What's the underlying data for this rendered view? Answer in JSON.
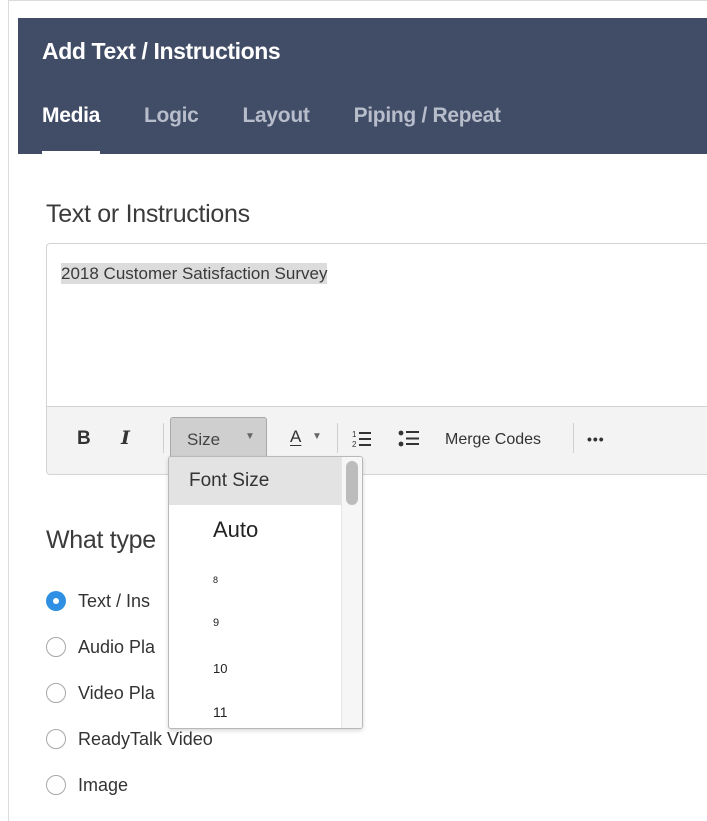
{
  "header": {
    "title": "Add Text / Instructions",
    "tabs": [
      {
        "label": "Media",
        "active": true
      },
      {
        "label": "Logic",
        "active": false
      },
      {
        "label": "Layout",
        "active": false
      },
      {
        "label": "Piping / Repeat",
        "active": false
      }
    ]
  },
  "editor": {
    "section_title": "Text or Instructions",
    "content": "2018 Customer Satisfaction Survey",
    "toolbar": {
      "bold_label": "B",
      "italic_label": "I",
      "size_label": "Size",
      "color_label": "A",
      "merge_codes_label": "Merge Codes",
      "more_label": "•••"
    }
  },
  "font_size_dropdown": {
    "header": "Font Size",
    "options": [
      "Auto",
      "8",
      "9",
      "10",
      "11"
    ]
  },
  "question_type": {
    "title": "What type",
    "options": [
      {
        "label": "Text / Ins",
        "checked": true
      },
      {
        "label": "Audio Pla",
        "checked": false
      },
      {
        "label": "Video Pla",
        "checked": false
      },
      {
        "label": "ReadyTalk Video",
        "checked": false
      },
      {
        "label": "Image",
        "checked": false
      }
    ]
  },
  "colors": {
    "header_bg": "#414c66",
    "radio_checked": "#2f90e3"
  }
}
